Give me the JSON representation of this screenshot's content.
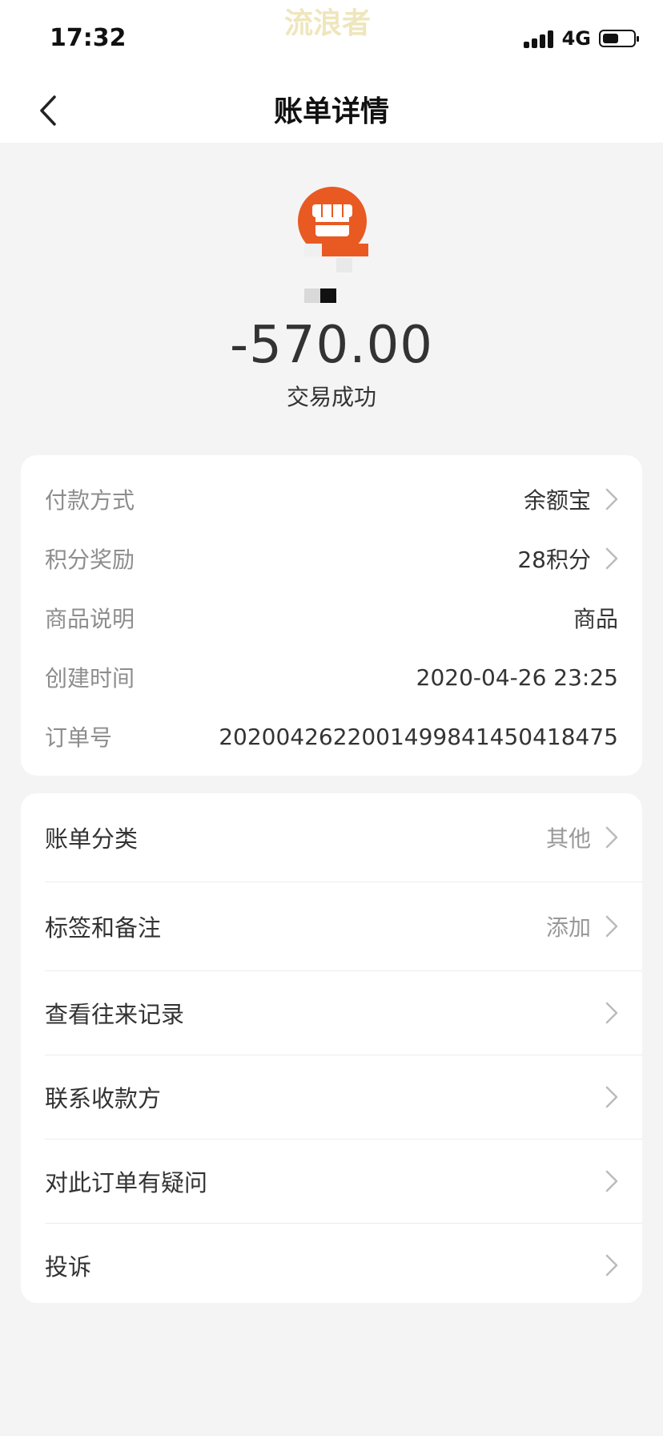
{
  "status_bar": {
    "time": "17:32",
    "watermark": "流浪者",
    "network": "4G",
    "signal_icon": "signal-bars-icon",
    "battery_icon": "battery-icon"
  },
  "nav": {
    "title": "账单详情",
    "back_icon": "chevron-left-icon"
  },
  "header": {
    "merchant_icon": "store-icon",
    "amount": "-570.00",
    "status": "交易成功",
    "brand_color": "#e85a22"
  },
  "details": [
    {
      "label": "付款方式",
      "value": "余额宝",
      "has_arrow": true
    },
    {
      "label": "积分奖励",
      "value": "28积分",
      "has_arrow": true
    },
    {
      "label": "商品说明",
      "value": "商品",
      "has_arrow": false
    },
    {
      "label": "创建时间",
      "value": "2020-04-26 23:25",
      "has_arrow": false
    },
    {
      "label": "订单号",
      "value": "2020042622001499841450418475",
      "has_arrow": false
    }
  ],
  "actions": [
    {
      "label": "账单分类",
      "value": "其他"
    },
    {
      "label": "标签和备注",
      "value": "添加"
    },
    {
      "label": "查看往来记录",
      "value": ""
    },
    {
      "label": "联系收款方",
      "value": ""
    },
    {
      "label": "对此订单有疑问",
      "value": ""
    },
    {
      "label": "投诉",
      "value": ""
    }
  ]
}
